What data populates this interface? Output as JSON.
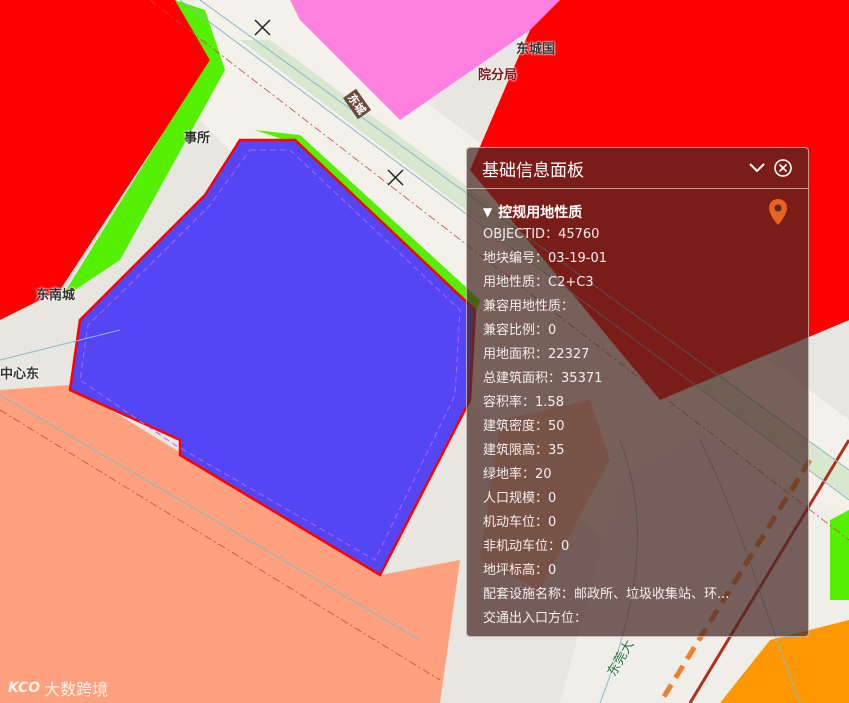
{
  "map": {
    "labels": {
      "dongcheng": "东城国",
      "fenju": "院分局",
      "banshichu": "事所",
      "nancheng": "东南城",
      "zhongxin": "中心东",
      "road_vertical": "东莞大",
      "road_name_2": "东城"
    }
  },
  "panel": {
    "title": "基础信息面板",
    "collapse_icon": "chevron-down-icon",
    "close_icon": "close-circle-icon",
    "section": {
      "toggle": "▼",
      "title": "控规用地性质",
      "location_icon": "map-pin-icon",
      "pin_color": "#e8631f"
    },
    "attributes": [
      {
        "key": "OBJECTID",
        "value": "45760"
      },
      {
        "key": "地块编号",
        "value": "03-19-01"
      },
      {
        "key": "用地性质",
        "value": "C2+C3"
      },
      {
        "key": "兼容用地性质",
        "value": ""
      },
      {
        "key": "兼容比例",
        "value": "0"
      },
      {
        "key": "用地面积",
        "value": "22327"
      },
      {
        "key": "总建筑面积",
        "value": "35371"
      },
      {
        "key": "容积率",
        "value": "1.58"
      },
      {
        "key": "建筑密度",
        "value": "50"
      },
      {
        "key": "建筑限高",
        "value": "35"
      },
      {
        "key": "绿地率",
        "value": "20"
      },
      {
        "key": "人口规模",
        "value": "0"
      },
      {
        "key": "机动车位",
        "value": "0"
      },
      {
        "key": "非机动车位",
        "value": "0"
      },
      {
        "key": "地坪标高",
        "value": "0"
      },
      {
        "key": "配套设施名称",
        "value": "邮政所、垃圾收集站、环..."
      },
      {
        "key": "交通出入口方位",
        "value": ""
      }
    ]
  },
  "watermark": {
    "logo": "KCO",
    "text": "大数跨境"
  },
  "colors": {
    "commercial_red": "#ff0000",
    "selected_blue": "#5546f5",
    "green": "#55f000",
    "pink": "#ff80e0",
    "salmon": "#ffa07e",
    "orange": "#ff9800"
  }
}
